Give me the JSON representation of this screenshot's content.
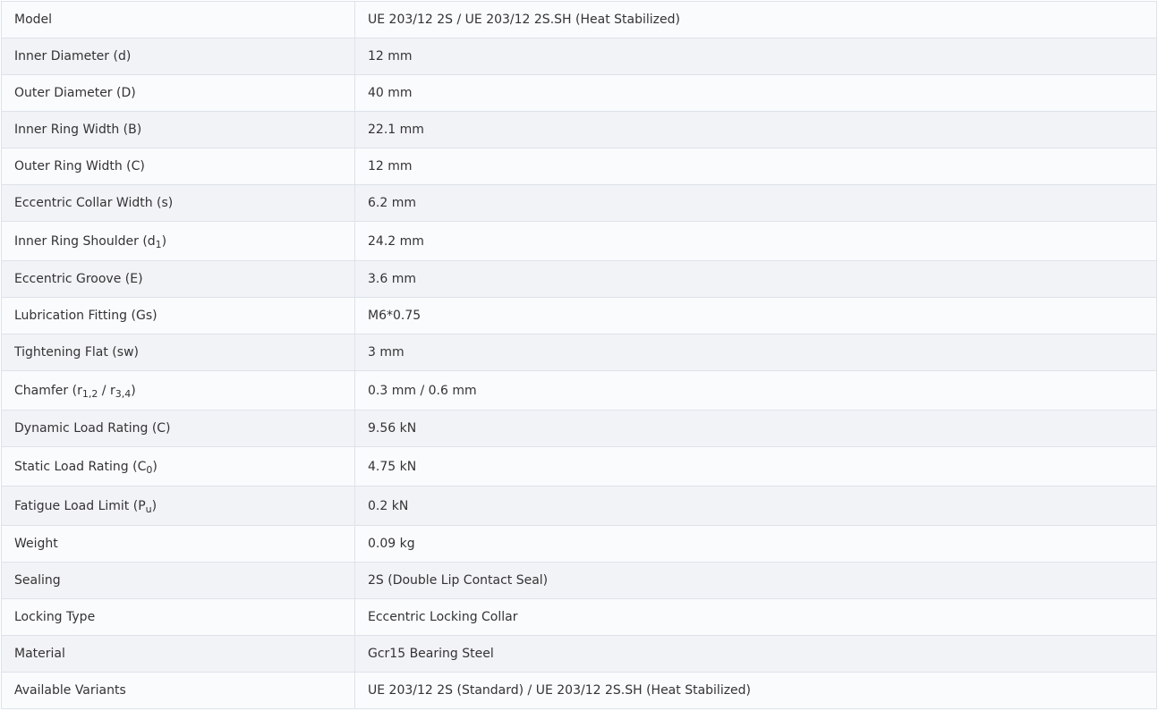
{
  "rows": [
    {
      "label": "Model",
      "value": "UE 203/12 2S / UE 203/12 2S.SH (Heat Stabilized)"
    },
    {
      "label": "Inner Diameter (d)",
      "value": "12 mm"
    },
    {
      "label": "Outer Diameter (D)",
      "value": "40 mm"
    },
    {
      "label": "Inner Ring Width (B)",
      "value": "22.1 mm"
    },
    {
      "label": "Outer Ring Width (C)",
      "value": "12 mm"
    },
    {
      "label": "Eccentric Collar Width (s)",
      "value": "6.2 mm"
    },
    {
      "label_pre": "Inner Ring Shoulder (d",
      "label_sub": "1",
      "label_post": ")",
      "value": "24.2 mm"
    },
    {
      "label": "Eccentric Groove (E)",
      "value": "3.6 mm"
    },
    {
      "label": "Lubrication Fitting (Gs)",
      "value": "M6*0.75"
    },
    {
      "label": "Tightening Flat (sw)",
      "value": "3 mm"
    },
    {
      "label_pre": "Chamfer (r",
      "label_sub": "1,2",
      "label_mid": " / r",
      "label_sub2": "3,4",
      "label_post": ")",
      "value": "0.3 mm / 0.6 mm"
    },
    {
      "label": "Dynamic Load Rating (C)",
      "value": "9.56 kN"
    },
    {
      "label_pre": "Static Load Rating (C",
      "label_sub": "0",
      "label_post": ")",
      "value": "4.75 kN"
    },
    {
      "label_pre": "Fatigue Load Limit (P",
      "label_sub": "u",
      "label_post": ")",
      "value": "0.2 kN"
    },
    {
      "label": "Weight",
      "value": "0.09 kg"
    },
    {
      "label": "Sealing",
      "value": "2S (Double Lip Contact Seal)"
    },
    {
      "label": "Locking Type",
      "value": "Eccentric Locking Collar"
    },
    {
      "label": "Material",
      "value": "Gcr15 Bearing Steel"
    },
    {
      "label": "Available Variants",
      "value": "UE 203/12 2S (Standard) / UE 203/12 2S.SH (Heat Stabilized)"
    }
  ]
}
